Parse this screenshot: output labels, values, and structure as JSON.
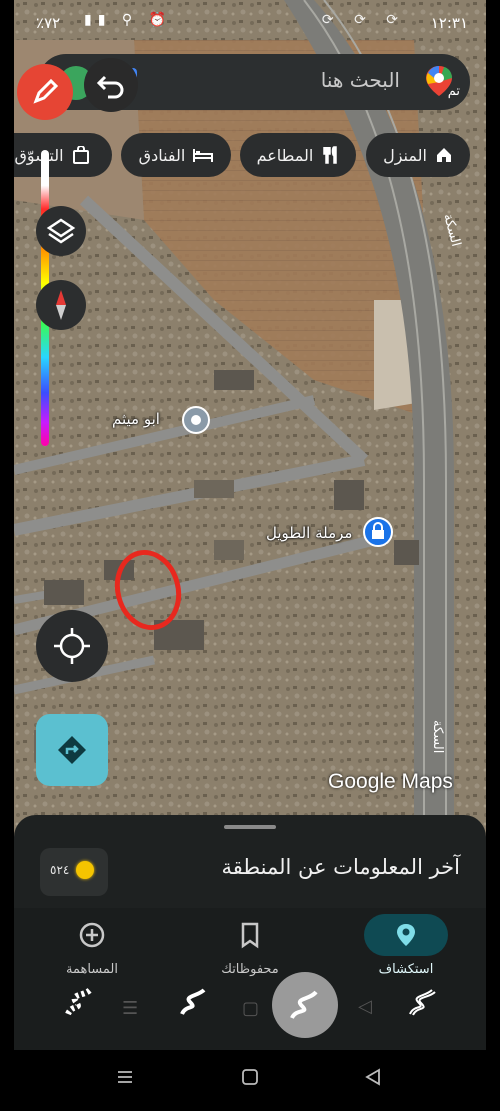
{
  "status_bar": {
    "time": "١٢:٣١",
    "left_text": "٪٧٢"
  },
  "search": {
    "placeholder": "البحث هنا",
    "account_label": "تم"
  },
  "chips": [
    {
      "label": "المنزل",
      "icon": "home-icon"
    },
    {
      "label": "المطاعم",
      "icon": "restaurant-icon"
    },
    {
      "label": "الفنادق",
      "icon": "hotel-icon"
    },
    {
      "label": "التسوّق",
      "icon": "shopping-bag-icon"
    }
  ],
  "map": {
    "poi_1": "ابو ميثم",
    "poi_2": "مرملة الطويل",
    "road_label_1": "السكة",
    "road_label_2": "السكة",
    "brand": "Google Maps",
    "colors": {
      "annotation": "#e8281e",
      "poi_pin": "#1a73e8",
      "accent": "#5bc0d0"
    }
  },
  "sheet": {
    "title": "آخر المعلومات عن المنطقة",
    "coins": "٥٢٤"
  },
  "bottom_nav": {
    "explore": "استكشاف",
    "saved": "محفوظاتك",
    "contribute": "المساهمة"
  }
}
